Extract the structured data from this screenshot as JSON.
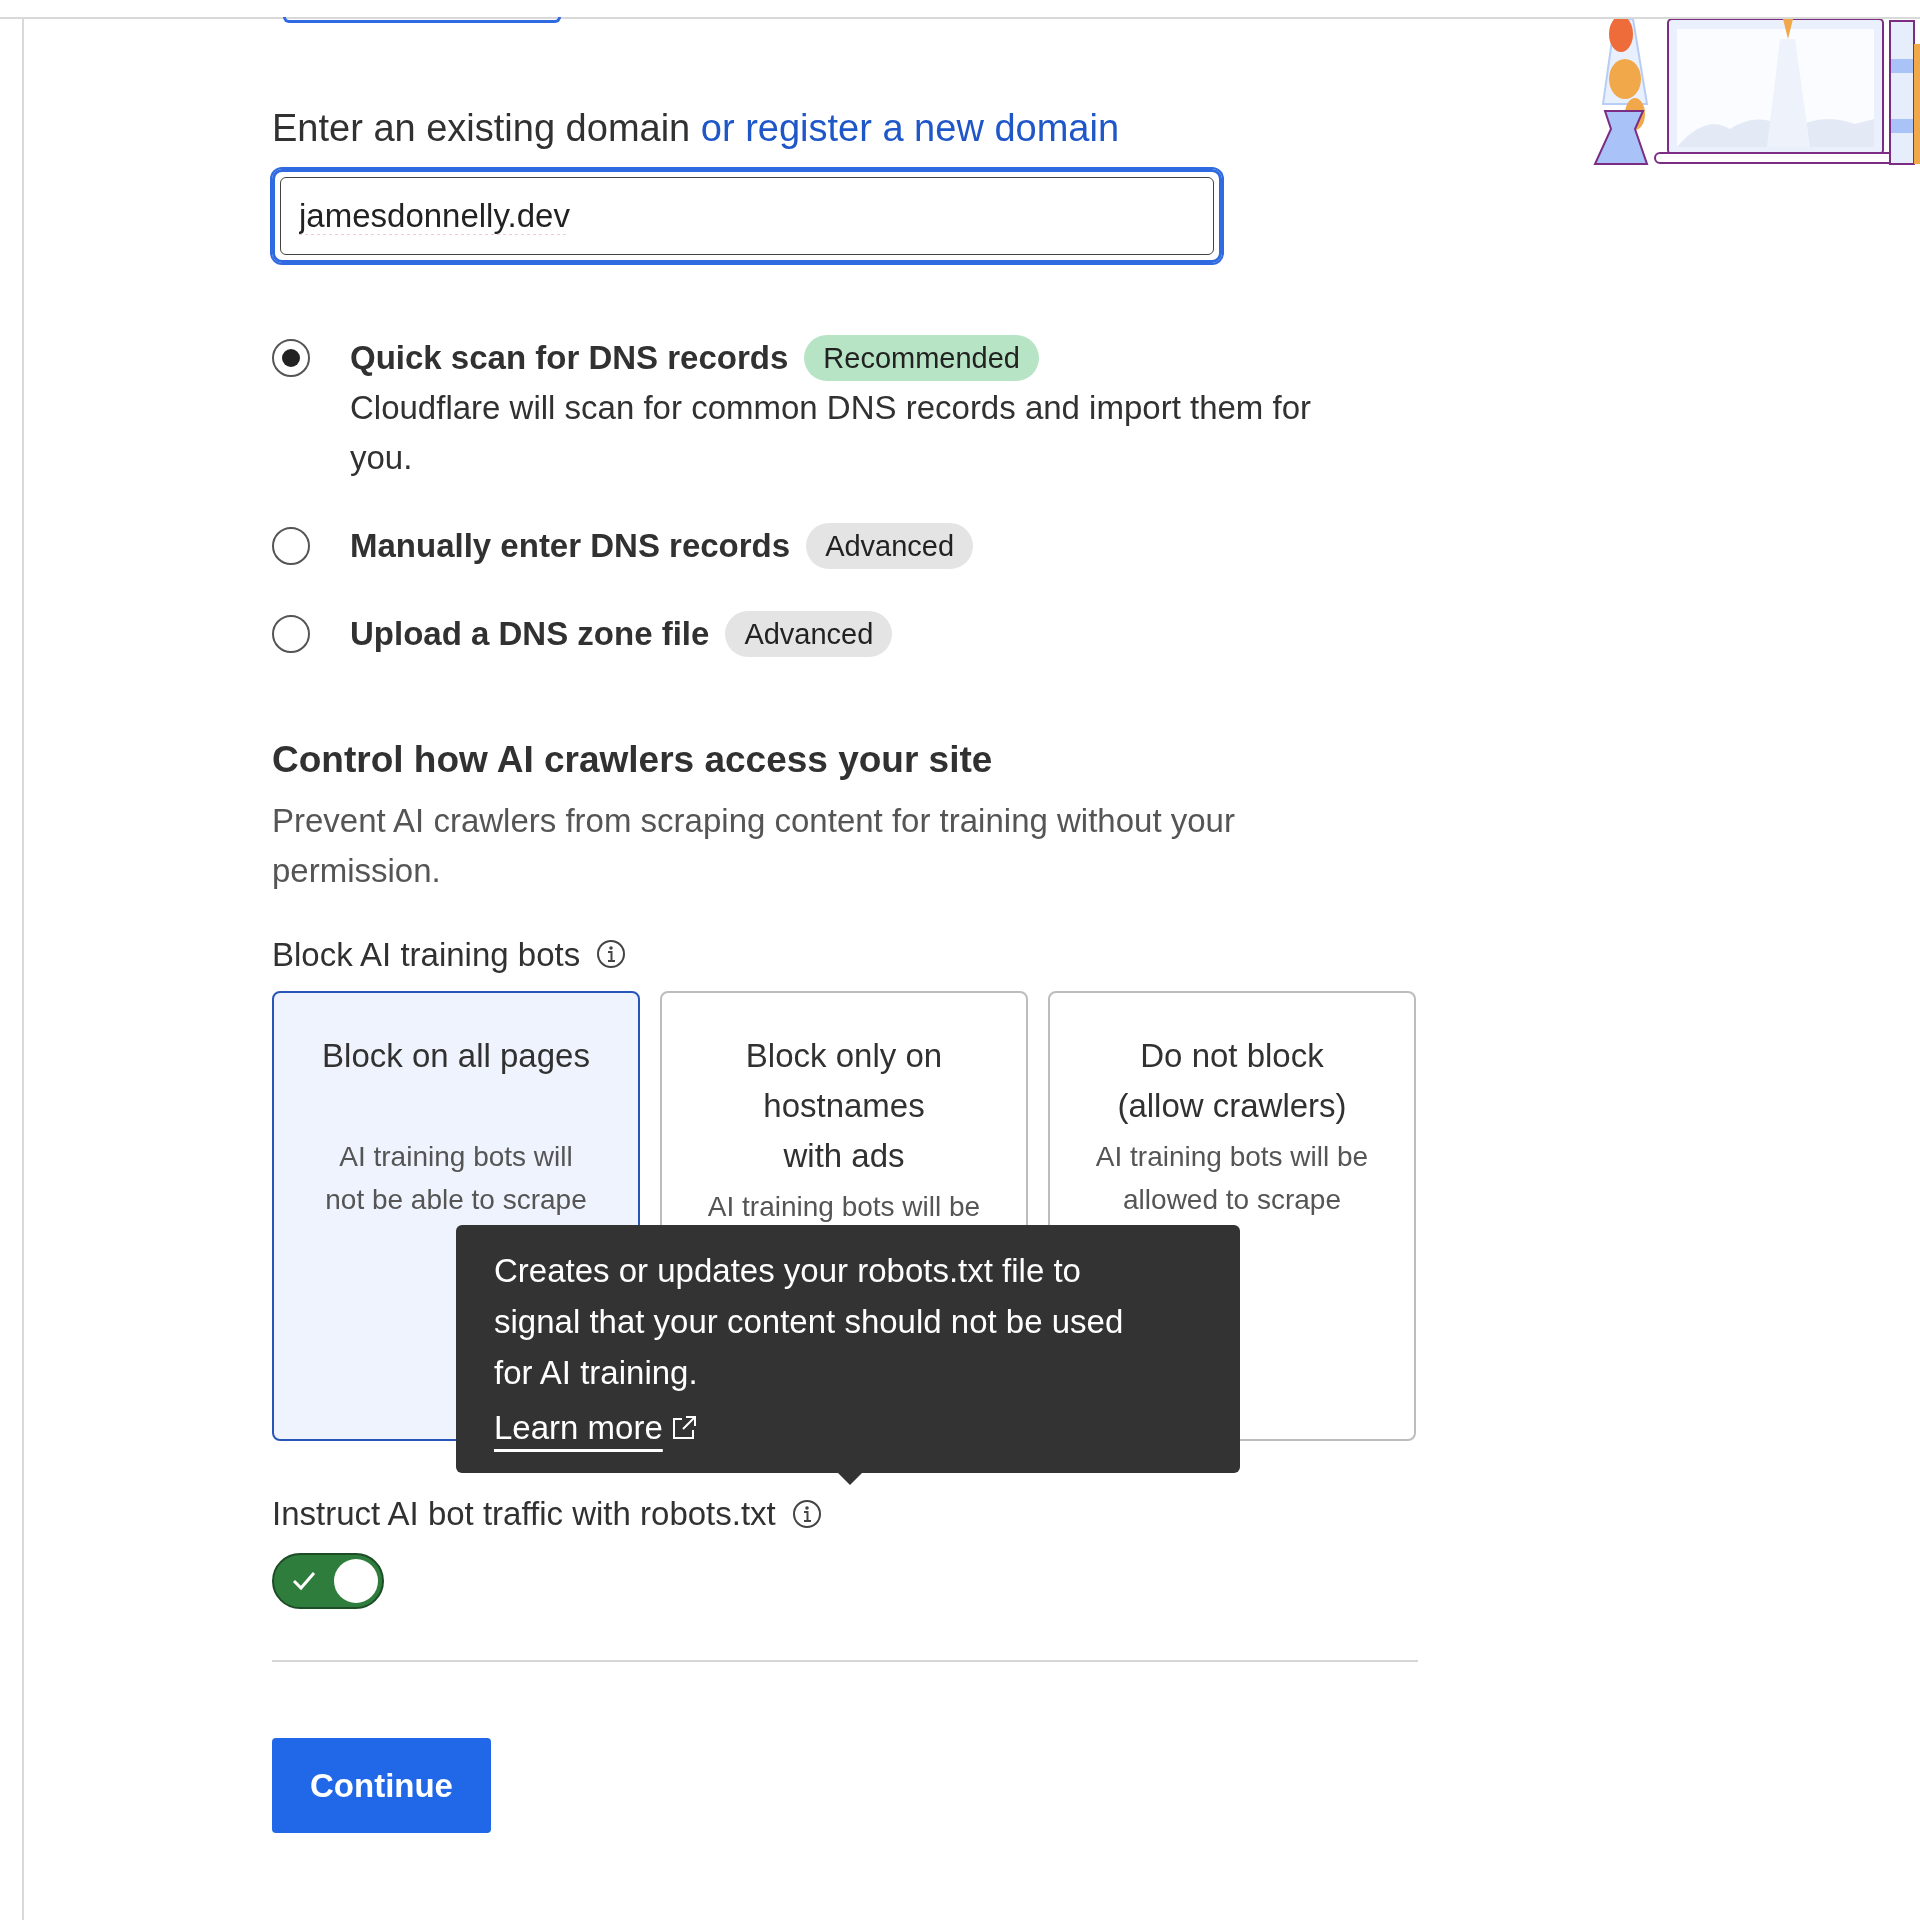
{
  "domain": {
    "label": "Enter an existing domain",
    "link": "or register a new domain",
    "value": "jamesdonnelly.dev"
  },
  "scan_options": [
    {
      "label": "Quick scan for DNS records",
      "badge": {
        "text": "Recommended",
        "color": "#b7e4c4"
      },
      "description": "Cloudflare will scan for common DNS records and import them for you.",
      "selected": true
    },
    {
      "label": "Manually enter DNS records",
      "badge": {
        "text": "Advanced",
        "color": "#e4e4e4"
      },
      "selected": false
    },
    {
      "label": "Upload a DNS zone file",
      "badge": {
        "text": "Advanced",
        "color": "#e4e4e4"
      },
      "selected": false
    }
  ],
  "ai_section": {
    "title": "Control how AI crawlers access your site",
    "description": "Prevent AI crawlers from scraping content for training without your permission.",
    "block_label": "Block AI training bots",
    "options": [
      {
        "title_lines": [
          "Block on all pages"
        ],
        "description_lines": [
          "AI training bots will",
          "not be able to scrape"
        ],
        "selected": true
      },
      {
        "title_lines": [
          "Block only on",
          "hostnames",
          "with ads"
        ],
        "description_lines": [
          "AI training bots will be"
        ],
        "selected": false
      },
      {
        "title_lines": [
          "Do not block",
          "(allow crawlers)"
        ],
        "description_lines": [
          "AI training bots will be",
          "allowed to scrape"
        ],
        "selected": false
      }
    ],
    "tooltip": {
      "text": "Creates or updates your robots.txt file to signal that your content should not be used for AI training.",
      "link": "Learn more"
    },
    "robots_label": "Instruct AI bot traffic with robots.txt",
    "robots_toggle": {
      "on": true
    }
  },
  "continue_button": "Continue"
}
